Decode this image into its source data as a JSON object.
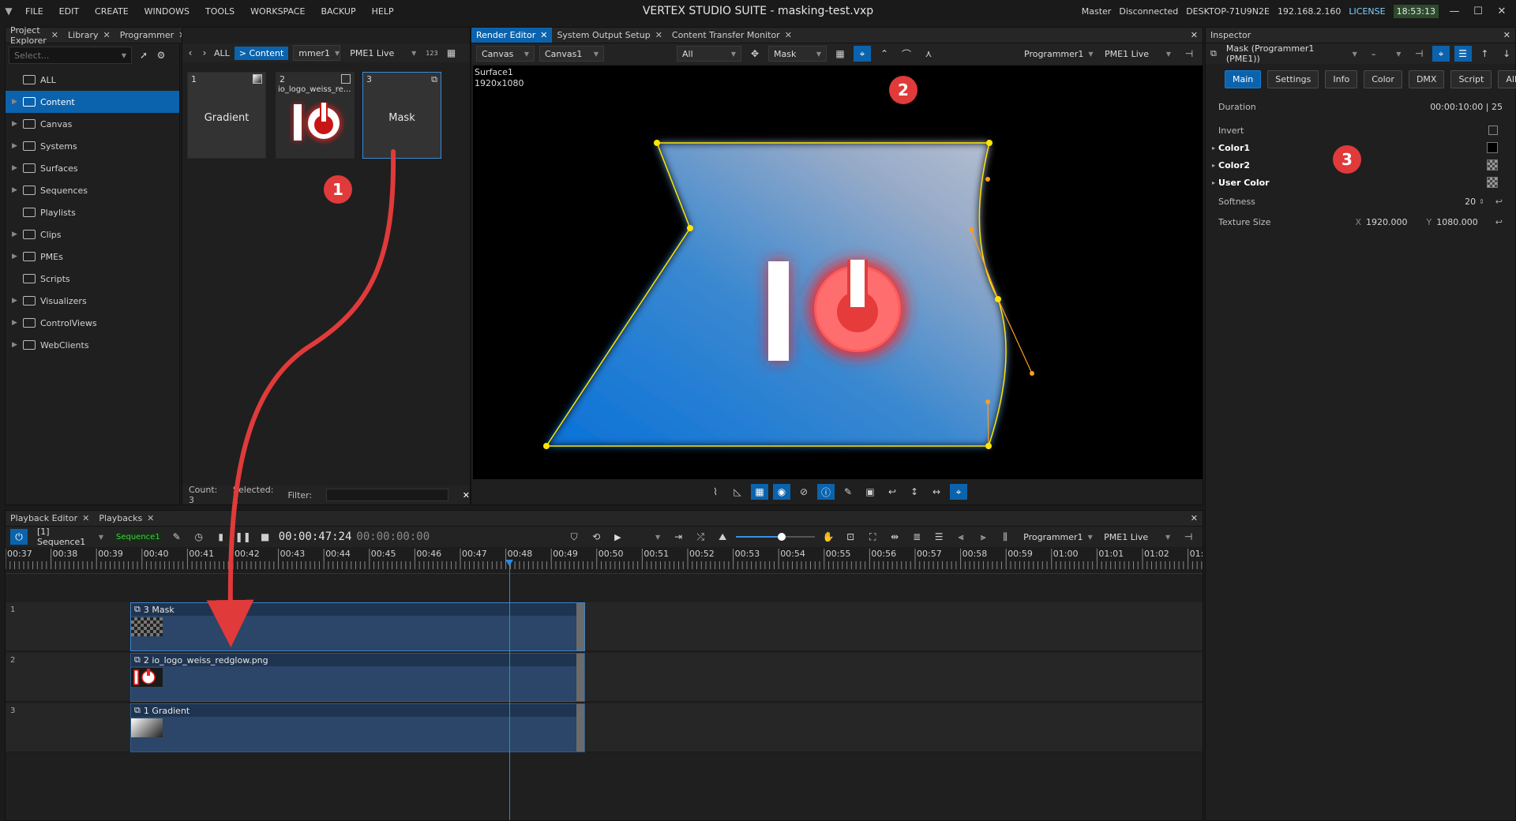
{
  "menubar": {
    "items": [
      "FILE",
      "EDIT",
      "CREATE",
      "WINDOWS",
      "TOOLS",
      "WORKSPACE",
      "BACKUP",
      "HELP"
    ],
    "title": "VERTEX STUDIO SUITE - masking-test.vxp",
    "status_mode": "Master",
    "status_conn": "Disconnected",
    "host": "DESKTOP-71U9N2E",
    "ip": "192.168.2.160",
    "license": "LICENSE",
    "time": "18:53:13"
  },
  "left_tabs": [
    {
      "label": "Project Explorer"
    },
    {
      "label": "Library"
    },
    {
      "label": "Programmer"
    }
  ],
  "project_explorer": {
    "search_placeholder": "Select...",
    "items": [
      {
        "label": "ALL"
      },
      {
        "label": "Content"
      },
      {
        "label": "Canvas"
      },
      {
        "label": "Systems"
      },
      {
        "label": "Surfaces"
      },
      {
        "label": "Sequences"
      },
      {
        "label": "Playlists"
      },
      {
        "label": "Clips"
      },
      {
        "label": "PMEs"
      },
      {
        "label": "Scripts"
      },
      {
        "label": "Visualizers"
      },
      {
        "label": "ControlViews"
      },
      {
        "label": "WebClients"
      }
    ]
  },
  "library": {
    "filter_all": "ALL",
    "crumb": "> Content",
    "programmer": "mmer1",
    "pme": "PME1 Live",
    "count_badge": "123",
    "tiles": [
      {
        "num": "1",
        "label": "Gradient"
      },
      {
        "num": "2",
        "label": "io_logo_weiss_re..."
      },
      {
        "num": "3",
        "label": "Mask"
      }
    ],
    "count": "Count: 3",
    "selected": "Selected: 1",
    "filter": "Filter:"
  },
  "render_tabs": [
    {
      "label": "Render Editor"
    },
    {
      "label": "System Output Setup"
    },
    {
      "label": "Content Transfer Monitor"
    }
  ],
  "render_editor": {
    "dd_canvas": "Canvas",
    "dd_canvas1": "Canvas1",
    "dd_all": "All",
    "dd_mask": "Mask",
    "programmer": "Programmer1",
    "pme": "PME1 Live",
    "surface_name": "Surface1",
    "surface_size": "1920x1080"
  },
  "inspector": {
    "tab": "Inspector",
    "target": "Mask (Programmer1 (PME1))",
    "dash": "–",
    "tabs": [
      "Main",
      "Settings",
      "Info",
      "Color",
      "DMX",
      "Script",
      "All"
    ],
    "duration_label": "Duration",
    "duration_value": "00:00:10:00 | 25",
    "invert_label": "Invert",
    "color1_label": "Color1",
    "color2_label": "Color2",
    "user_color_label": "User Color",
    "softness_label": "Softness",
    "softness_value": "20",
    "texture_label": "Texture Size",
    "tex_x_label": "X",
    "tex_x": "1920.000",
    "tex_y_label": "Y",
    "tex_y": "1080.000"
  },
  "playback_tabs": [
    {
      "label": "Playback Editor"
    },
    {
      "label": "Playbacks"
    }
  ],
  "playback": {
    "sequence": "[1] Sequence1",
    "sequence_badge": "Sequence1",
    "timecode": "00:00:47:24",
    "timecode2": "00:00:00:00",
    "programmer": "Programmer1",
    "pme": "PME1 Live",
    "ruler": [
      "00:37",
      "00:38",
      "00:39",
      "00:40",
      "00:41",
      "00:42",
      "00:43",
      "00:44",
      "00:45",
      "00:46",
      "00:47",
      "00:48",
      "00:49",
      "00:50",
      "00:51",
      "00:52",
      "00:53",
      "00:54",
      "00:55",
      "00:56",
      "00:57",
      "00:58",
      "00:59",
      "01:00",
      "01:01",
      "01:02",
      "01:0"
    ],
    "playhead_pos": 0.42,
    "slider_pos": 0.58,
    "tracks": [
      {
        "num": "1",
        "clip": "3 Mask"
      },
      {
        "num": "2",
        "clip": "2 io_logo_weiss_redglow.png"
      },
      {
        "num": "3",
        "clip": "1 Gradient"
      }
    ],
    "canvas_label": "Canvas1"
  },
  "annotations": [
    "1",
    "2",
    "3"
  ],
  "colors": {
    "accent": "#0b63ad",
    "badge": "#e03a3a",
    "mask_outline": "#ffe600",
    "handle": "#ff9e1f"
  }
}
